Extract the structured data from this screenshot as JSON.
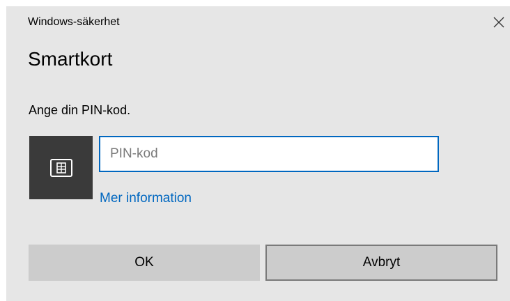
{
  "window": {
    "title": "Windows-säkerhet",
    "close_icon": "close-icon"
  },
  "dialog": {
    "heading": "Smartkort",
    "prompt": "Ange din PIN-kod.",
    "card_icon": "smart-card-icon",
    "pin_input": {
      "value": "",
      "placeholder": "PIN-kod"
    },
    "more_info_link": "Mer information"
  },
  "buttons": {
    "ok_label": "OK",
    "cancel_label": "Avbryt"
  },
  "colors": {
    "dialog_background": "#e6e6e6",
    "accent": "#0067c0",
    "tile_background": "#3a3a3a",
    "button_background": "#cccccc"
  }
}
